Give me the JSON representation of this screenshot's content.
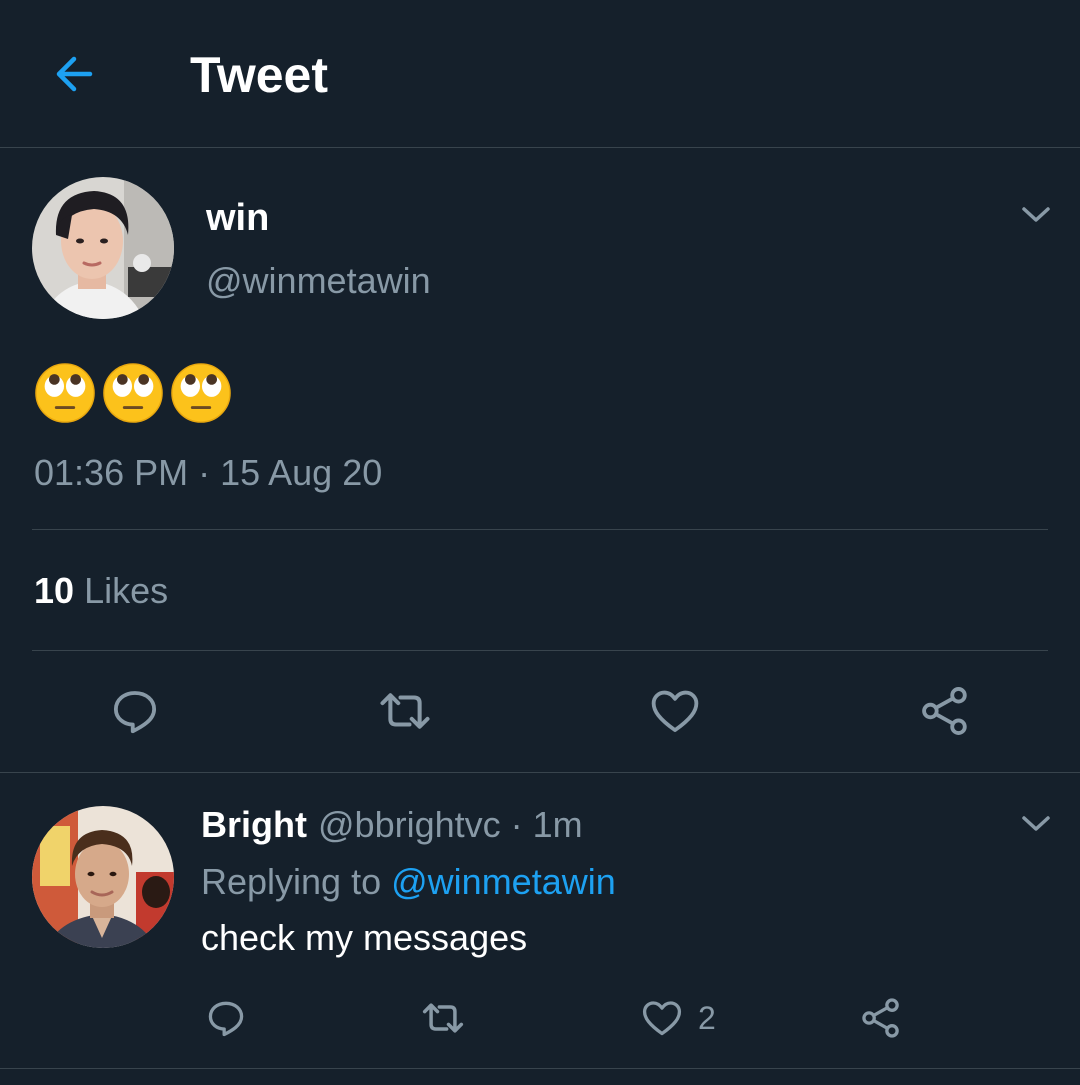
{
  "header": {
    "title": "Tweet",
    "back_icon": "arrow-left-icon"
  },
  "colors": {
    "background": "#15202b",
    "divider": "#38444d",
    "accent": "#1da1f2",
    "secondary_text": "#8899a6"
  },
  "tweet": {
    "author_name": "win",
    "author_handle": "@winmetawin",
    "content_emoji": [
      "face-with-rolling-eyes",
      "face-with-rolling-eyes",
      "face-with-rolling-eyes"
    ],
    "timestamp": "01:36 PM · 15 Aug 20",
    "likes_count": "10",
    "likes_label": "Likes",
    "actions": [
      "reply-icon",
      "retweet-icon",
      "like-icon",
      "share-icon"
    ]
  },
  "reply": {
    "author_name": "Bright",
    "author_handle": "@bbrightvc",
    "time": "· 1m",
    "replying_prefix": "Replying to",
    "replying_to": "@winmetawin",
    "text": "check my messages",
    "like_count": "2",
    "actions": [
      "reply-icon",
      "retweet-icon",
      "like-icon",
      "share-icon"
    ]
  }
}
